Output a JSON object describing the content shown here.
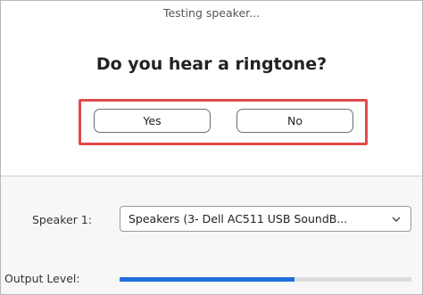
{
  "dialog": {
    "status_text": "Testing speaker...",
    "question": "Do you hear a ringtone?",
    "yes_label": "Yes",
    "no_label": "No",
    "highlight_color": "#e04a4a"
  },
  "speaker": {
    "label": "Speaker 1:",
    "selected": "Speakers (3- Dell AC511 USB SoundB...",
    "dropdown_icon": "chevron-down-icon"
  },
  "output": {
    "label": "Output Level:",
    "level_fraction": 0.6,
    "level_color": "#1f70db"
  }
}
